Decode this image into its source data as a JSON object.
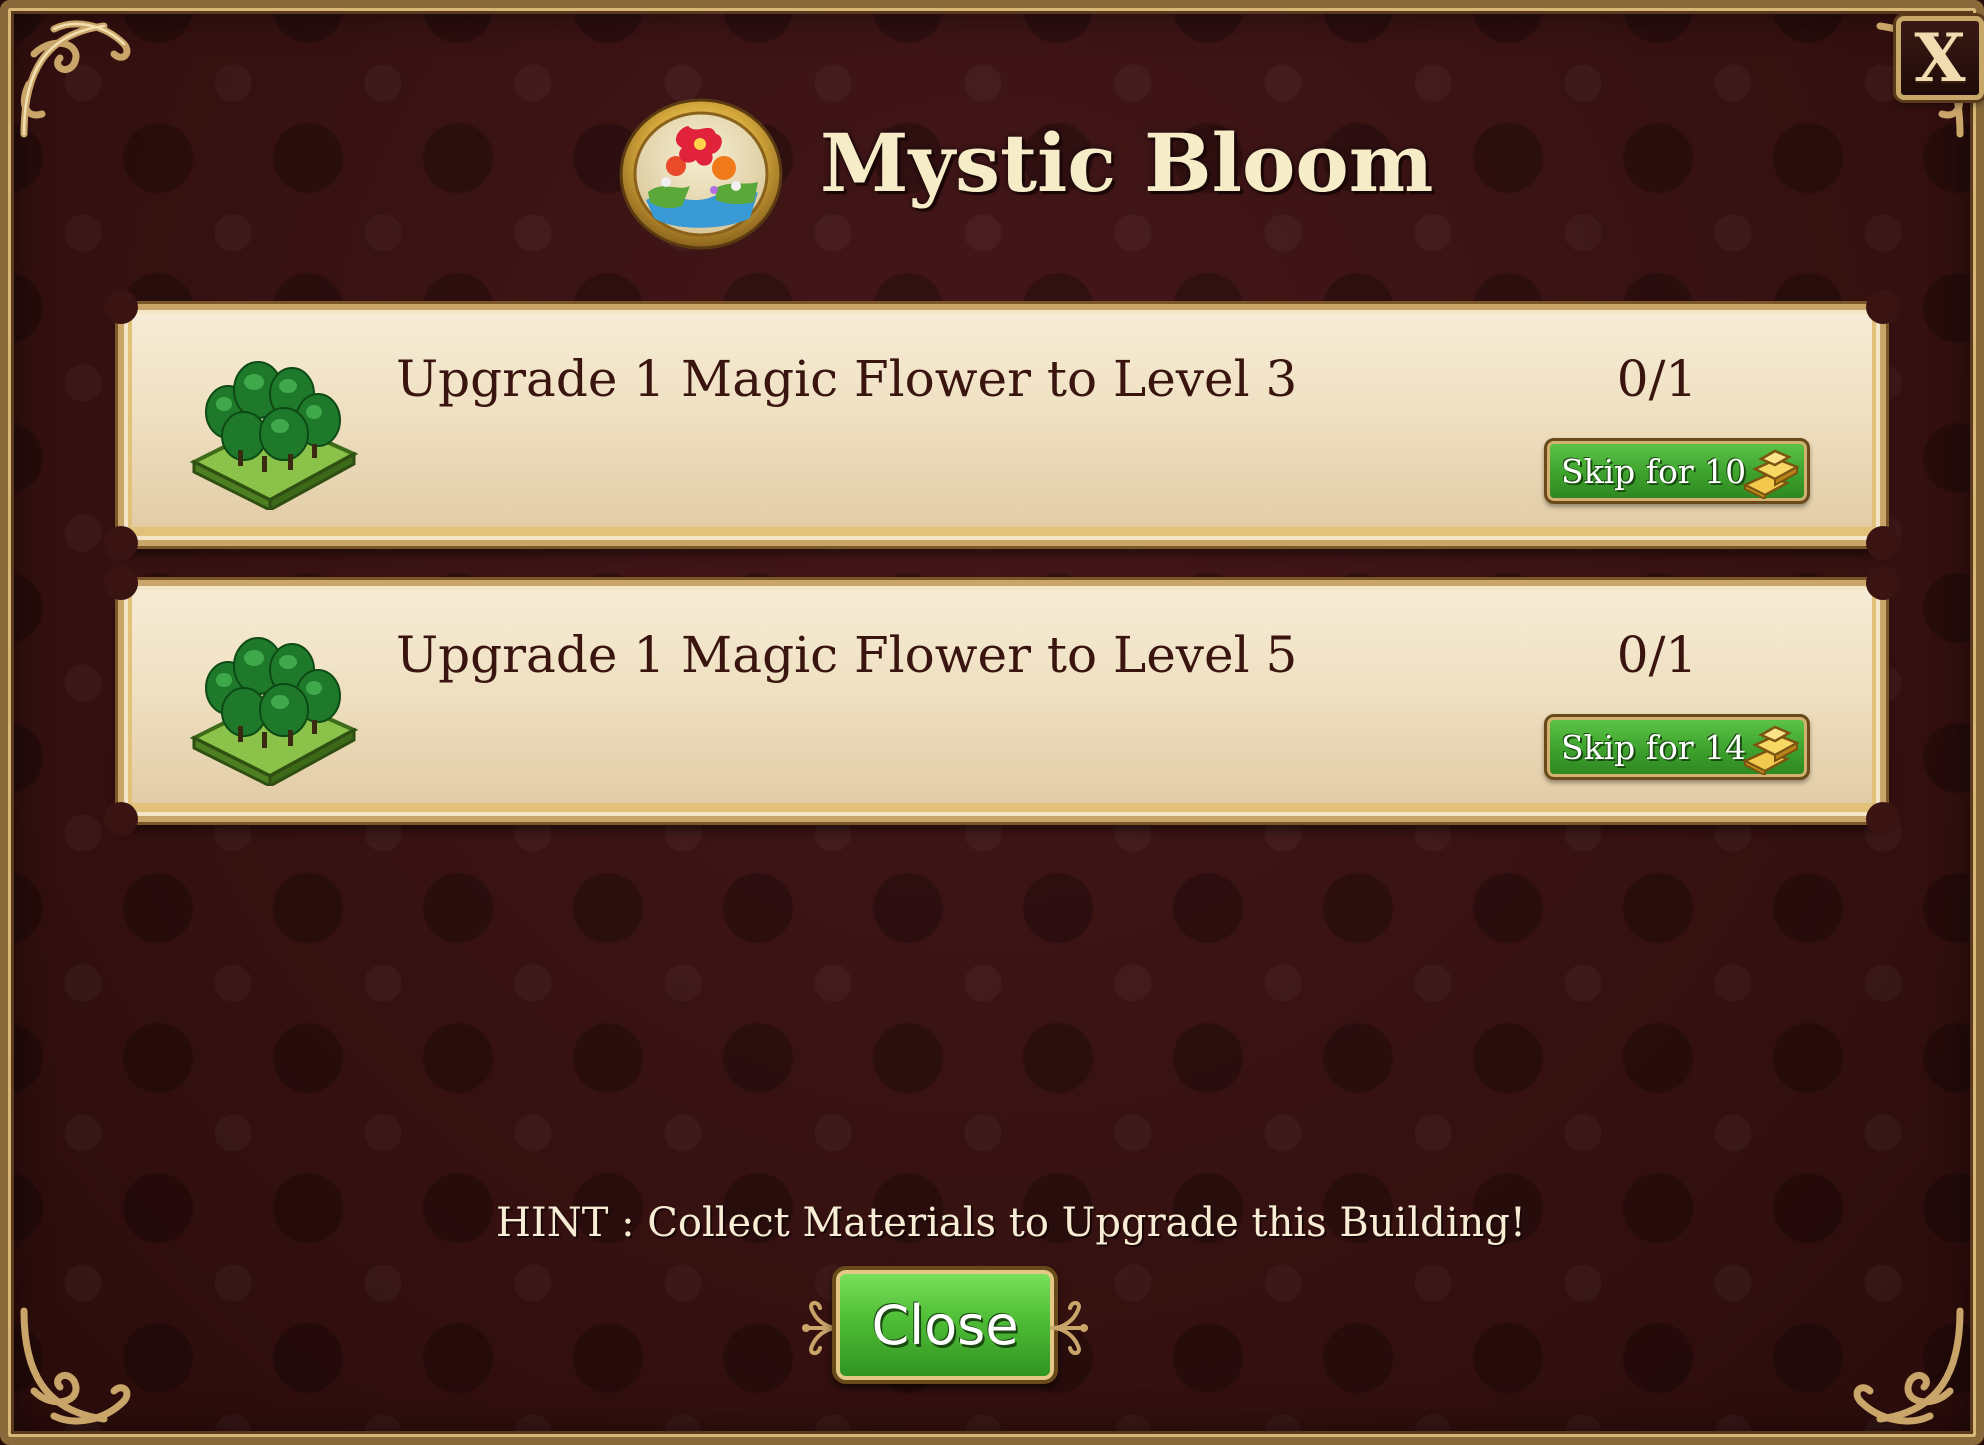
{
  "dialog": {
    "title": "Mystic Bloom",
    "close_x_label": "X",
    "medal_icon": "mystic-bloom-medal-icon"
  },
  "tasks": [
    {
      "icon": "magic-flower-icon",
      "text": "Upgrade 1 Magic Flower to Level 3",
      "progress": "0/1",
      "skip_label": "Skip for 10",
      "currency_icon": "gold-bars-icon"
    },
    {
      "icon": "magic-flower-icon",
      "text": "Upgrade 1 Magic Flower to Level 5",
      "progress": "0/1",
      "skip_label": "Skip for 14",
      "currency_icon": "gold-bars-icon"
    }
  ],
  "footer": {
    "hint": "HINT : Collect Materials to Upgrade this Building!",
    "close_label": "Close"
  },
  "colors": {
    "background": "#3a1412",
    "panel": "#f0e2c4",
    "frame_gold": "#c9a56a",
    "button_green": "#4fbd36",
    "title_text": "#f7ecc8",
    "task_text": "#3a1510"
  }
}
